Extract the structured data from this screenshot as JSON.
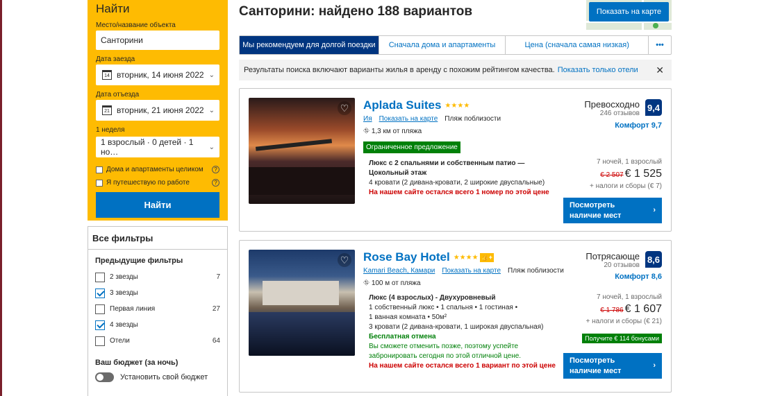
{
  "search": {
    "title": "Найти",
    "destination_label": "Место/название объекта",
    "destination_value": "Санторини",
    "checkin_label": "Дата заезда",
    "checkin_value": "вторник, 14 июня 2022",
    "checkin_day": "14",
    "checkout_label": "Дата отъезда",
    "checkout_value": "вторник, 21 июня 2022",
    "checkout_day": "21",
    "nights": "1 неделя",
    "guests_value": "1 взрослый · 0 детей · 1 но…",
    "option_homes": "Дома и апартаменты целиком",
    "option_work": "Я путешествую по работе",
    "button": "Найти"
  },
  "filters": {
    "title": "Все фильтры",
    "previous_title": "Предыдущие фильтры",
    "items": [
      {
        "label": "2 звезды",
        "count": "7",
        "checked": false
      },
      {
        "label": "3 звезды",
        "count": "",
        "checked": true
      },
      {
        "label": "Первая линия",
        "count": "27",
        "checked": false
      },
      {
        "label": "4 звезды",
        "count": "",
        "checked": true
      },
      {
        "label": "Отели",
        "count": "64",
        "checked": false
      }
    ],
    "budget_title": "Ваш бюджет (за ночь)",
    "budget_toggle": "Установить свой бюджет"
  },
  "header": {
    "title": "Санторини: найдено 188 вариантов",
    "map_button": "Показать на карте"
  },
  "tabs": [
    {
      "label": "Мы рекомендуем для долгой поездки",
      "active": true
    },
    {
      "label": "Сначала дома и апартаменты",
      "active": false
    },
    {
      "label": "Цена (сначала самая низкая)",
      "active": false
    },
    {
      "label": "•••",
      "active": false
    }
  ],
  "info": {
    "text": "Результаты поиска включают варианты жилья в аренду с похожим рейтингом качества.",
    "link": "Показать только отели",
    "close": "✕"
  },
  "hotels": [
    {
      "name": "Aplada Suites",
      "stars": "★★★★",
      "location": "Ия",
      "map_link": "Показать на карте",
      "beach": "Пляж поблизости",
      "distance": "1,3 км от пляжа",
      "deal": "Ограниченное предложение",
      "room_title": "Люкс с 2 спальнями и собственным патио — Цокольный этаж",
      "room_beds": "4 кровати (2 дивана-кровати, 2 широкие двуспальные)",
      "urgency": "На нашем сайте остался всего 1 номер по этой цене",
      "review_word": "Превосходно",
      "review_count": "246 отзывов",
      "score": "9,4",
      "comfort": "Комфорт 9,7",
      "stay": "7 ночей, 1 взрослый",
      "old_price": "€ 2 507",
      "price": "€ 1 525",
      "taxes": "+ налоги и сборы (€ 7)",
      "button": "Посмотреть наличие мест",
      "arrow": "›"
    },
    {
      "name": "Rose Bay Hotel",
      "stars": "★★★★",
      "thumb": "👍+",
      "location": "Kamari Beach, Камари",
      "map_link": "Показать на карте",
      "beach": "Пляж поблизости",
      "distance": "100 м от пляжа",
      "room_title": "Люкс (4 взрослых) - Двухуровневый",
      "room_line1": "1 собственный люкс • 1 спальня • 1 гостиная •",
      "room_line2": "1 ванная комната • 50м²",
      "room_beds": "3 кровати (2 дивана-кровати, 1 широкая двуспальная)",
      "free_cancel": "Бесплатная отмена",
      "cancel_note": "Вы сможете отменить позже, поэтому успейте забронировать сегодня по этой отличной цене.",
      "urgency": "На нашем сайте остался всего 1 вариант по этой цене",
      "review_word": "Потрясающе",
      "review_count": "20 отзывов",
      "score": "8,6",
      "comfort": "Комфорт 8,6",
      "stay": "7 ночей, 1 взрослый",
      "old_price": "€ 1 786",
      "price": "€ 1 607",
      "taxes": "+ налоги и сборы (€ 21)",
      "bonus": "Получите € 114 бонусами",
      "button": "Посмотреть наличие мест",
      "arrow": "›"
    }
  ],
  "colors": {
    "brand_yellow": "#febb02",
    "brand_blue": "#0071c2",
    "dark_blue": "#003580",
    "green": "#008009",
    "red": "#cc0000"
  }
}
